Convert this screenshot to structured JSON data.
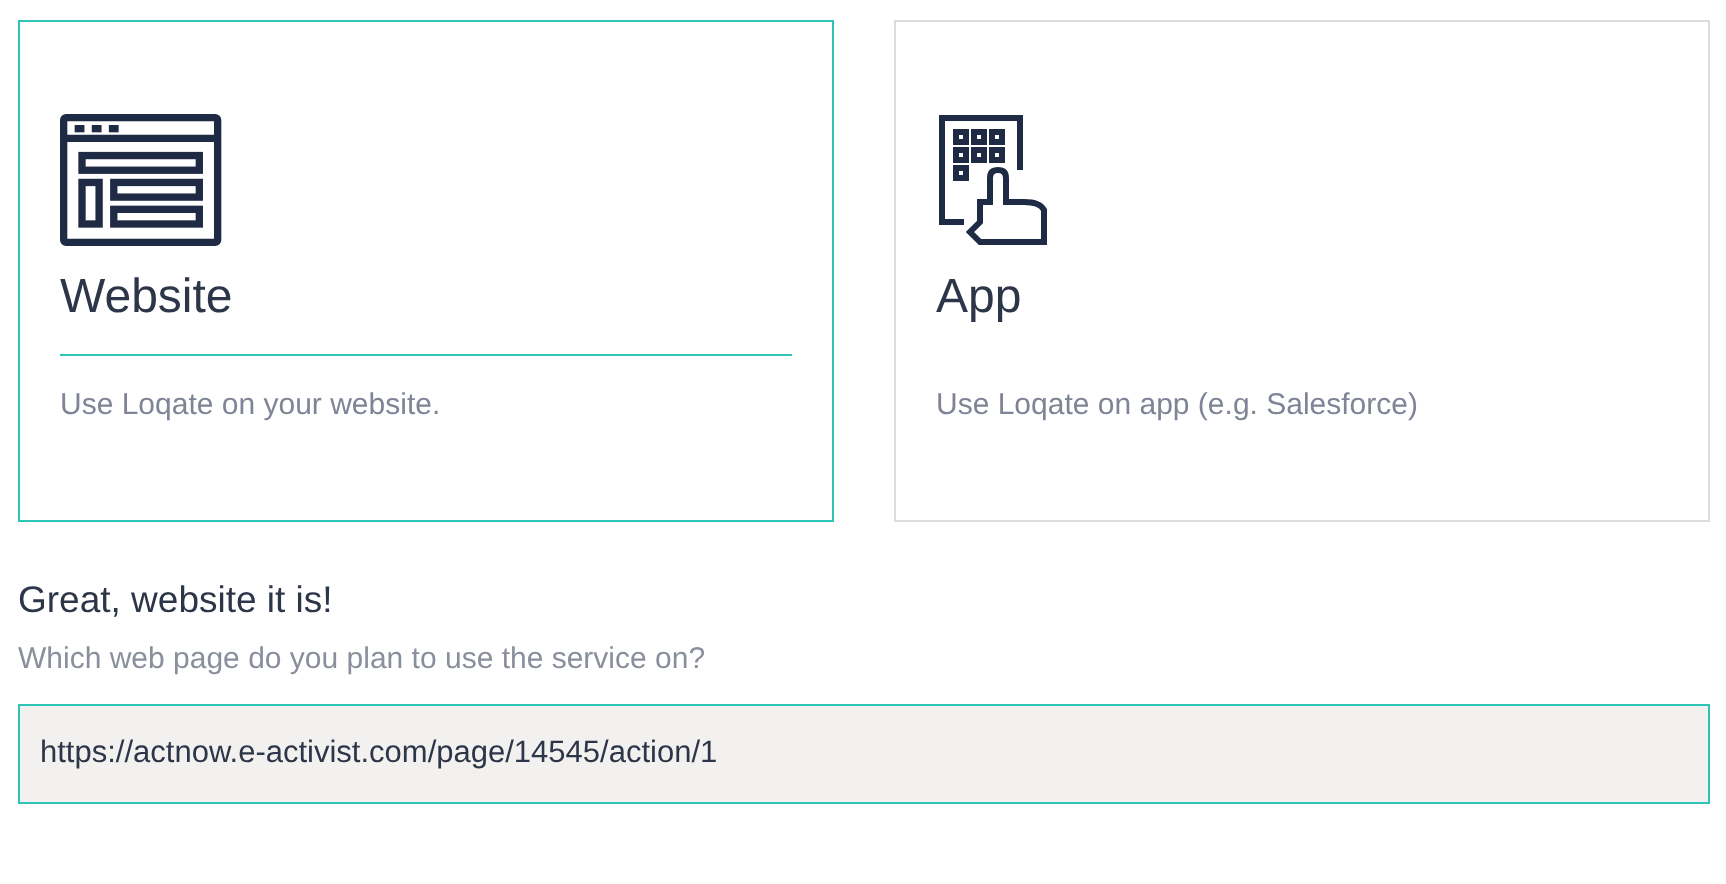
{
  "options": [
    {
      "kind": "website",
      "title": "Website",
      "description": "Use Loqate on your website.",
      "selected": true
    },
    {
      "kind": "app",
      "title": "App",
      "description": "Use Loqate on app (e.g. Salesforce)",
      "selected": false
    }
  ],
  "confirmation": {
    "heading": "Great, website it is!",
    "question": "Which web page do you plan to use the service on?",
    "value": "https://actnow.e-activist.com/page/14545/action/1"
  }
}
